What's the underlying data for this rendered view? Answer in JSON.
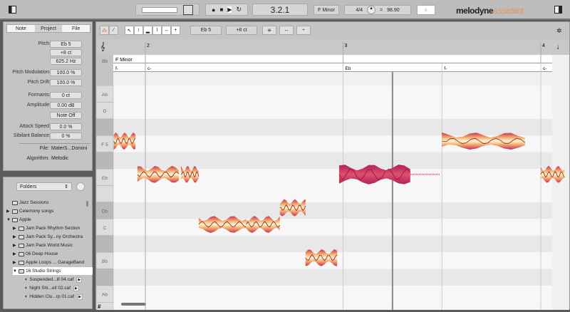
{
  "transport": {
    "position": "3.2.1",
    "key": "F Minor",
    "time_signature": "4/4",
    "tempo_separator": "=",
    "tempo": "98.90"
  },
  "brand": {
    "name": "melodyne",
    "edition": "assistant",
    "accent": "#e8935a"
  },
  "inspector": {
    "tabs": [
      {
        "label": "Note",
        "active": false
      },
      {
        "label": "Project",
        "active": true
      },
      {
        "label": "File",
        "active": false
      }
    ],
    "params": [
      {
        "label": "Pitch:",
        "value": "Eb 5"
      },
      {
        "label": "",
        "value": "+8 ct"
      },
      {
        "label": "",
        "value": "625.2 Hz"
      },
      {
        "label": "Pitch Modulation:",
        "value": "100.0 %"
      },
      {
        "label": "Pitch Drift:",
        "value": "100.0 %"
      },
      {
        "label": "Formants:",
        "value": "0 ct"
      },
      {
        "label": "Amplitude:",
        "value": "0.00 dB"
      },
      {
        "label": "",
        "value": "Note Off"
      },
      {
        "label": "Attack Speed:",
        "value": "0.0 %"
      },
      {
        "label": "Sibilant Balance:",
        "value": "0 %"
      }
    ],
    "file_label": "File:",
    "file": "MaterS...Domini",
    "algorithm_label": "Algorithm:",
    "algorithm": "Melodic"
  },
  "browser": {
    "selector": "Folders",
    "items": [
      {
        "label": "Jazz Sessions",
        "level": 0,
        "type": "folder",
        "expand": ""
      },
      {
        "label": "Celemony songs",
        "level": 0,
        "type": "folder",
        "expand": "▶"
      },
      {
        "label": "Apple",
        "level": 0,
        "type": "folder",
        "expand": "▼"
      },
      {
        "label": "Jam Pack Rhythm Section",
        "level": 1,
        "type": "folder",
        "expand": "▶"
      },
      {
        "label": "Jam Pack Sy...ny Orchestra",
        "level": 1,
        "type": "folder",
        "expand": "▶"
      },
      {
        "label": "Jam Pack World Music",
        "level": 1,
        "type": "folder",
        "expand": "▶"
      },
      {
        "label": "06 Deep House",
        "level": 1,
        "type": "folder",
        "expand": "▶"
      },
      {
        "label": "Apple Loops ... GarageBand",
        "level": 1,
        "type": "folder",
        "expand": "▶"
      },
      {
        "label": "16 Studio Strings",
        "level": 1,
        "type": "folder",
        "expand": "▼",
        "selected": true
      },
      {
        "label": "Suspended...ill 04.caf",
        "level": 2,
        "type": "file",
        "expand": ""
      },
      {
        "label": "Night Shi...ell 02.caf",
        "level": 2,
        "type": "file",
        "expand": ""
      },
      {
        "label": "Hidden Clu...rp 01.caf",
        "level": 2,
        "type": "file",
        "expand": ""
      }
    ]
  },
  "toolbar": {
    "pitch": "Eb 5",
    "cents": "+8 ct"
  },
  "editor": {
    "bars": [
      "2",
      "3",
      "4"
    ],
    "scale": "F Minor",
    "chords": [
      {
        "label": "f-",
        "bar": 1.8
      },
      {
        "label": "c-",
        "bar": 2.0
      },
      {
        "label": "Eb",
        "bar": 3.0
      },
      {
        "label": "f-",
        "bar": 3.5
      },
      {
        "label": "c-",
        "bar": 4.0
      }
    ],
    "pitch_labels": [
      {
        "label": "Bb",
        "semi": 0
      },
      {
        "label": "Ab",
        "semi": 2
      },
      {
        "label": "G",
        "semi": 3
      },
      {
        "label": "F 5",
        "semi": 5
      },
      {
        "label": "Eb",
        "semi": 7
      },
      {
        "label": "Db",
        "semi": 9
      },
      {
        "label": "C",
        "semi": 10
      },
      {
        "label": "Bb",
        "semi": 12
      },
      {
        "label": "Ab",
        "semi": 14
      }
    ],
    "notes": [
      {
        "pitch": "F 5",
        "start": 1.84,
        "end": 1.95
      },
      {
        "pitch": "Eb",
        "start": 1.96,
        "end": 2.17
      },
      {
        "pitch": "Eb",
        "start": 2.18,
        "end": 2.27
      },
      {
        "pitch": "C",
        "start": 2.27,
        "end": 2.51
      },
      {
        "pitch": "C",
        "start": 2.51,
        "end": 2.68
      },
      {
        "pitch": "Db",
        "start": 2.68,
        "end": 2.81
      },
      {
        "pitch": "Bb",
        "start": 2.81,
        "end": 2.97
      },
      {
        "pitch": "Eb",
        "start": 2.98,
        "end": 3.34,
        "selected": true
      },
      {
        "pitch": "F 5",
        "start": 3.5,
        "end": 3.92
      },
      {
        "pitch": "Eb",
        "start": 4.0,
        "end": 4.12
      }
    ],
    "playhead_bar": 3.25
  }
}
